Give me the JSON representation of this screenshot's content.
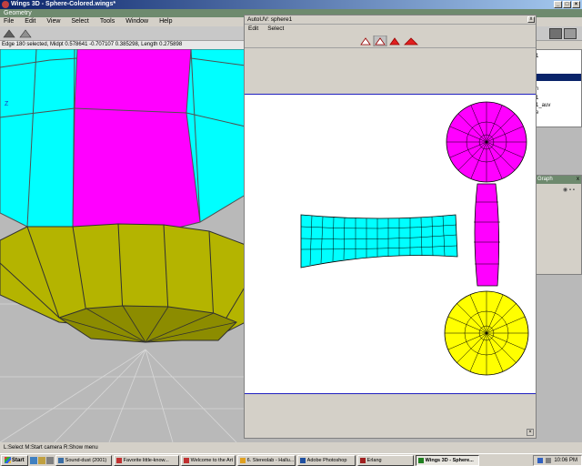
{
  "window": {
    "title": "Wings 3D - Sphere-Colored.wings*"
  },
  "geometry_bar": {
    "label": "Geometry"
  },
  "menu": [
    "File",
    "Edit",
    "View",
    "Select",
    "Tools",
    "Window",
    "Help"
  ],
  "status_line": "Edge 180 selected, Midpt 0.578641 -0.707107 0.385298, Length 0.275898",
  "axis_label": "Z",
  "autouv": {
    "title": "AutoUV: sphere1",
    "menu": [
      "Edit",
      "Select"
    ],
    "close_label": "x"
  },
  "right_panel": {
    "list_items": [
      "1",
      "n",
      "1",
      "1_auv",
      "e"
    ],
    "graph_title": "Graph",
    "graph_close": "x"
  },
  "bottom_status": "L:Select   M:Start camera   R:Show menu",
  "taskbar": {
    "start_label": "Start",
    "tasks": [
      "Sound-dust (2001)",
      "Favorite little-know...",
      "Welcome to the Art ...",
      "6. Stereolab - Hallu...",
      "Adobe Photoshop",
      "Erlang",
      "Wings 3D - Sphere..."
    ],
    "clock": "10:06 PM"
  },
  "colors": {
    "cyan": "#00ffff",
    "magenta": "#ff00ff",
    "yellow": "#ffff00",
    "olive": "#b4b400",
    "uv_border": "#2020c0"
  }
}
